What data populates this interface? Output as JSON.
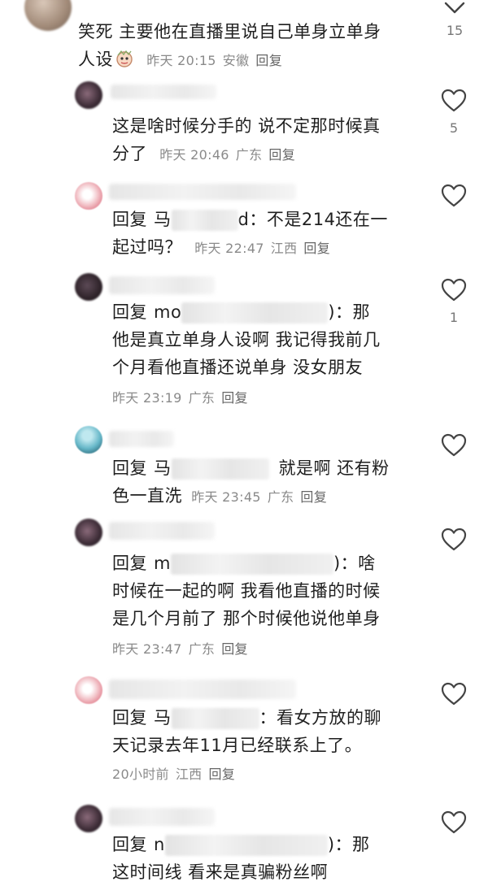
{
  "comment": {
    "text": "笑死 主要他在直播里说自己单身立单身人设",
    "text_line1": "笑死 主要他在直播里说自己单身立单身",
    "text_line2": "人设",
    "emoji_icon": "face-emoji-icon",
    "time": "昨天 20:15",
    "location": "安徽",
    "reply_label": "回复",
    "likes": "15"
  },
  "replies": [
    {
      "line1": "这是啥时候分手的 说不定那时候真",
      "line2": "分了",
      "time": "昨天 20:46",
      "location": "广东",
      "reply_label": "回复",
      "likes": "5"
    },
    {
      "reply_prefix": "回复",
      "mention_start": "马",
      "mention_end": "d",
      "line1_text": "：不是214还在一",
      "line2": "起过吗？",
      "time": "昨天 22:47",
      "location": "江西",
      "reply_label": "回复",
      "likes": ""
    },
    {
      "reply_prefix": "回复",
      "mention_start": "mo",
      "mention_end": ")",
      "line1_text": "：那",
      "line2": "他是真立单身人设啊 我记得我前几",
      "line3": "个月看他直播还说单身 没女朋友",
      "time": "昨天 23:19",
      "location": "广东",
      "reply_label": "回复",
      "likes": "1"
    },
    {
      "reply_prefix": "回复",
      "mention_start": "马",
      "line1_text": "就是啊 还有粉",
      "line2": "色一直洗",
      "time": "昨天 23:45",
      "location": "广东",
      "reply_label": "回复",
      "likes": ""
    },
    {
      "reply_prefix": "回复",
      "mention_start": "m",
      "mention_end": ")",
      "line1_text": "：啥",
      "line2": "时候在一起的啊 我看他直播的时候",
      "line3": "是几个月前了 那个时候他说他单身",
      "time": "昨天 23:47",
      "location": "广东",
      "reply_label": "回复",
      "likes": ""
    },
    {
      "reply_prefix": "回复",
      "mention_start": "马",
      "line1_text": "：看女方放的聊",
      "line2": "天记录去年11月已经联系上了。",
      "time": "20小时前",
      "location": "江西",
      "reply_label": "回复",
      "likes": ""
    },
    {
      "reply_prefix": "回复",
      "mention_start": "n",
      "mention_end": ")",
      "line1_text": "：那",
      "line2": "这时间线 看来是真骗粉丝啊",
      "likes": ""
    }
  ],
  "icons": {
    "like": "heart-outline-icon",
    "chevron": "chevron-down-icon"
  },
  "colors": {
    "meta_text": "#8a8a8a",
    "body_text": "#1f1f1f",
    "icon_stroke": "#444444"
  }
}
